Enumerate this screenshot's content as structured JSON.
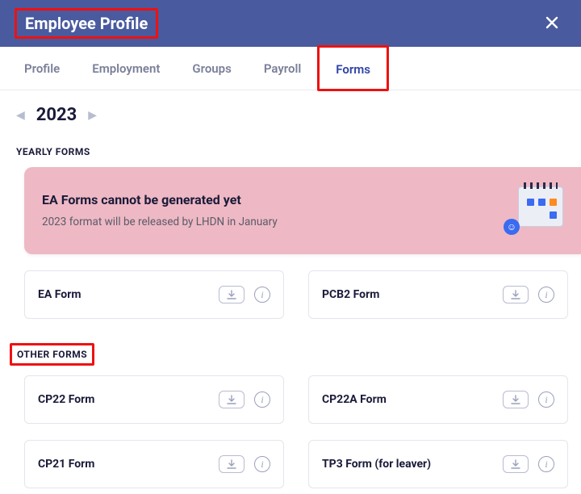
{
  "header": {
    "title": "Employee Profile"
  },
  "tabs": [
    {
      "label": "Profile",
      "active": false
    },
    {
      "label": "Employment",
      "active": false
    },
    {
      "label": "Groups",
      "active": false
    },
    {
      "label": "Payroll",
      "active": false
    },
    {
      "label": "Forms",
      "active": true
    }
  ],
  "year": "2023",
  "sections": {
    "yearly_label": "YEARLY FORMS",
    "other_label": "OTHER FORMS"
  },
  "notice": {
    "title": "EA Forms cannot be generated yet",
    "subtitle": "2023 format will be released by LHDN in January"
  },
  "yearly_forms": [
    {
      "name": "EA Form"
    },
    {
      "name": "PCB2 Form"
    }
  ],
  "other_forms": [
    {
      "name": "CP22 Form"
    },
    {
      "name": "CP22A Form"
    },
    {
      "name": "CP21 Form"
    },
    {
      "name": "TP3 Form (for leaver)"
    }
  ]
}
